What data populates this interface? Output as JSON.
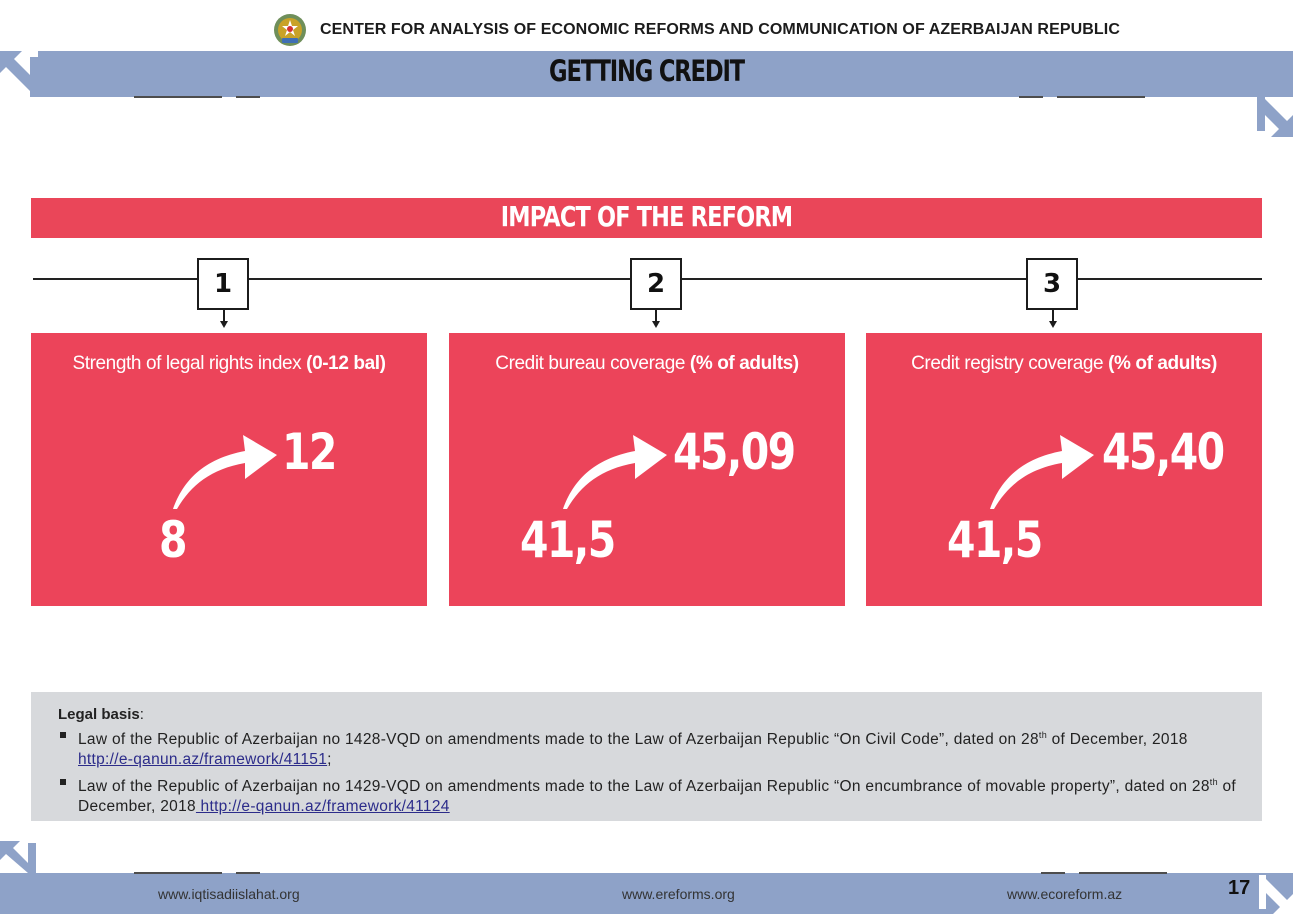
{
  "header": {
    "organization": "CENTER FOR ANALYSIS OF ECONOMIC REFORMS AND COMMUNICATION OF AZERBAIJAN REPUBLIC",
    "page_title": "GETTING CREDIT"
  },
  "impact": {
    "title": "IMPACT OF THE REFORM",
    "steps": [
      "1",
      "2",
      "3"
    ],
    "cards": [
      {
        "label": "Strength of legal rights index ",
        "label_unit": "(0-12 bal)",
        "before": "8",
        "after": "12"
      },
      {
        "label": "Credit bureau coverage ",
        "label_unit": "(% of adults)",
        "before": "41,5",
        "after": "45,09"
      },
      {
        "label": "Credit registry coverage ",
        "label_unit": "(% of adults)",
        "before": "41,5",
        "after": "45,40"
      }
    ]
  },
  "legal": {
    "heading": "Legal basis",
    "heading_suffix": ":",
    "items": [
      {
        "text_1": "Law of the Republic of Azerbaijan no 1428-VQD on amendments made to the Law of Azerbaijan Republic “On Civil Code”, dated on 28",
        "sup": "th",
        "text_2": " of December, 2018",
        "link": "http://e-qanun.az/framework/41151",
        "tail": ";"
      },
      {
        "text_1": "Law of the Republic of Azerbaijan no 1429-VQD on amendments made to the Law of Azerbaijan Republic “On encumbrance of movable property”, dated on 28",
        "sup": "th",
        "text_2": " of December, 2018",
        "link": " http://e-qanun.az/framework/41124",
        "tail": ""
      }
    ]
  },
  "footer": {
    "links": [
      "www.iqtisadiislahat.org",
      "www.ereforms.org",
      "www.ecoreform.az"
    ],
    "page_number": "17"
  },
  "colors": {
    "accent_red": "#ec445a",
    "band_blue": "#8ea2c8",
    "legal_gray": "#d7d9dc"
  }
}
